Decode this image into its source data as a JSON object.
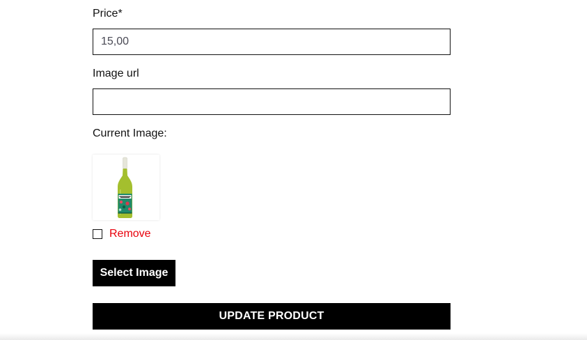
{
  "form": {
    "price": {
      "label": "Price*",
      "value": "15,00"
    },
    "image_url": {
      "label": "Image url",
      "value": "",
      "placeholder": ""
    },
    "current_image": {
      "label": "Current Image:",
      "icon": "wine-bottle-image"
    },
    "remove": {
      "label": "Remove",
      "checked": false,
      "color": "#e8000b"
    },
    "select_image_label": "Select Image",
    "update_product_label": "UPDATE PRODUCT"
  },
  "colors": {
    "button_bg": "#000000",
    "button_text": "#ffffff",
    "accent_red": "#e8000b"
  }
}
